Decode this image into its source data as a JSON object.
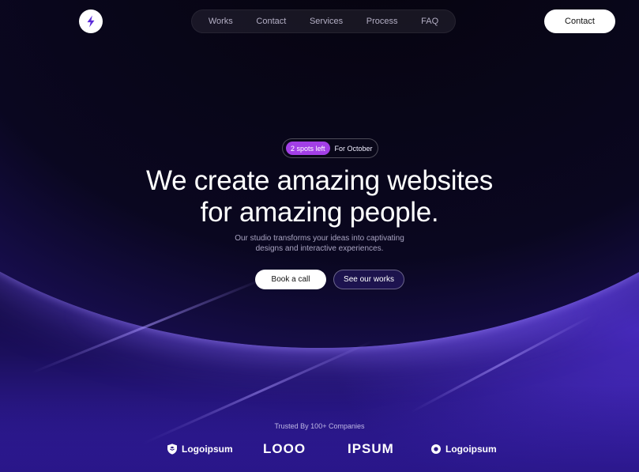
{
  "nav": {
    "links": [
      "Works",
      "Contact",
      "Services",
      "Process",
      "FAQ"
    ],
    "cta_label": "Contact"
  },
  "hero": {
    "badge_highlight": "2 spots left",
    "badge_text": "For October",
    "headline_line1": "We create amazing websites",
    "headline_line2": "for amazing people.",
    "subtitle_line1": "Our studio transforms your ideas into captivating",
    "subtitle_line2": "designs and interactive experiences.",
    "primary_cta": "Book a call",
    "secondary_cta": "See our works"
  },
  "trusted": {
    "label": "Trusted By 100+ Companies",
    "companies": [
      "Logoipsum",
      "LOOO",
      "IPSUM",
      "Logoipsum"
    ]
  },
  "icons": {
    "brand": "lightning-bolt-icon",
    "company_1": "shield-icon",
    "company_4": "ring-icon"
  },
  "colors": {
    "accent_pill": "#a23fe6",
    "primary_button": "#ffffff",
    "background": "#05030d",
    "glow": "#3b22b6"
  }
}
